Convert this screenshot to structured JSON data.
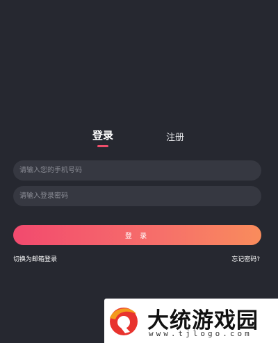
{
  "tabs": {
    "login": "登录",
    "register": "注册",
    "active": "login"
  },
  "form": {
    "phone_placeholder": "请输入您的手机号码",
    "phone_value": "",
    "password_placeholder": "请输入登录密码",
    "password_value": "",
    "login_button": "登 录"
  },
  "links": {
    "switch_email": "切换为邮箱登录",
    "forgot_password": "忘记密码?"
  },
  "watermark": {
    "title": "大统游戏园",
    "url": "www.tjlogo.com"
  },
  "colors": {
    "background": "#262830",
    "input_bg": "#363841",
    "accent": "#f04e6b",
    "gradient_start": "#f24a6e",
    "gradient_end": "#f98c5c"
  },
  "icons": {
    "watermark_logo": "red-swirl-logo-icon"
  }
}
